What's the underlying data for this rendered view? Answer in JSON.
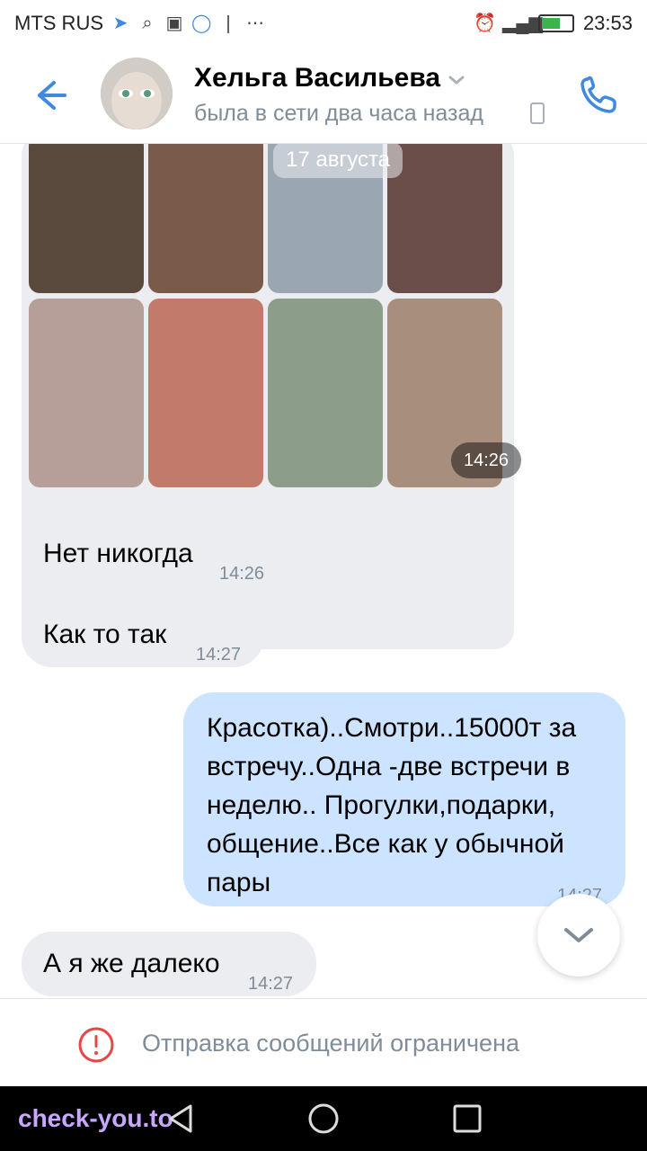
{
  "status_bar": {
    "carrier": "MTS RUS",
    "time": "23:53"
  },
  "header": {
    "contact_name": "Хельга Васильева",
    "status": "была в сети два часа назад"
  },
  "photos": {
    "date_label": "17 августа",
    "time": "14:26",
    "colors": [
      "#5a4a3e",
      "#7a5a4a",
      "#9aa6b2",
      "#6b4e4a",
      "#b69f98",
      "#c27b6b",
      "#8c9e8a",
      "#a88e7c"
    ]
  },
  "messages": [
    {
      "direction": "in",
      "text": "Нет никогда",
      "time": "14:26"
    },
    {
      "direction": "in",
      "text": "Как то так",
      "time": "14:27"
    },
    {
      "direction": "out",
      "text_lines": [
        "Красотка)..Смотри..15000т за",
        "встречу..Одна -две встречи в",
        "неделю.. Прогулки,подарки,",
        "общение..Все как у обычной",
        "пары"
      ],
      "time": "14:27"
    },
    {
      "direction": "in",
      "text": "А я же далеко",
      "time": "14:27"
    }
  ],
  "restriction": {
    "text": "Отправка сообщений ограничена"
  },
  "watermark": "check-you.to",
  "colors": {
    "accent": "#3f8ae0",
    "incoming_bubble": "#ebedf0",
    "outgoing_bubble": "#cce4ff",
    "secondary_text": "#818c99",
    "error": "#e64646"
  }
}
